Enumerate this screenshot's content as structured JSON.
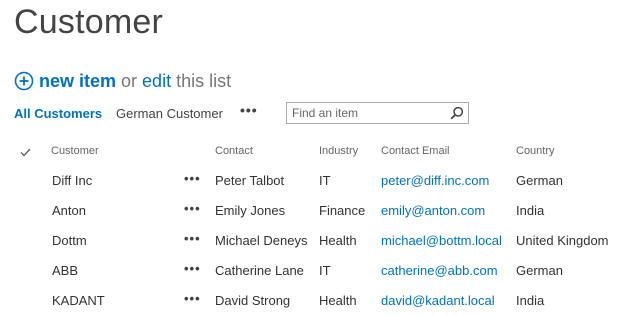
{
  "page": {
    "title": "Customer"
  },
  "toolbar": {
    "new_item_label": "new item",
    "or_text": "or",
    "edit_label": "edit",
    "this_list_text": "this list"
  },
  "views": {
    "tabs": [
      "All Customers",
      "German Customer"
    ],
    "more_label": "•••"
  },
  "search": {
    "placeholder": "Find an item",
    "icon": "search-icon"
  },
  "table": {
    "columns": [
      "Customer",
      "Contact",
      "Industry",
      "Contact Email",
      "Country"
    ],
    "row_menu_label": "•••",
    "rows": [
      {
        "customer": "Diff Inc",
        "contact": "Peter Talbot",
        "industry": "IT",
        "email": "peter@diff.inc.com",
        "country": "German"
      },
      {
        "customer": "Anton",
        "contact": "Emily Jones",
        "industry": "Finance",
        "email": "emily@anton.com",
        "country": "India"
      },
      {
        "customer": "Dottm",
        "contact": "Michael Deneys",
        "industry": "Health",
        "email": "michael@bottm.local",
        "country": "United Kingdom"
      },
      {
        "customer": "ABB",
        "contact": "Catherine Lane",
        "industry": "IT",
        "email": "catherine@abb.com",
        "country": "German"
      },
      {
        "customer": "KADANT",
        "contact": "David Strong",
        "industry": "Health",
        "email": "david@kadant.local",
        "country": "India"
      }
    ]
  },
  "colors": {
    "accent": "#0072c6",
    "text": "#333333",
    "muted": "#777777"
  }
}
